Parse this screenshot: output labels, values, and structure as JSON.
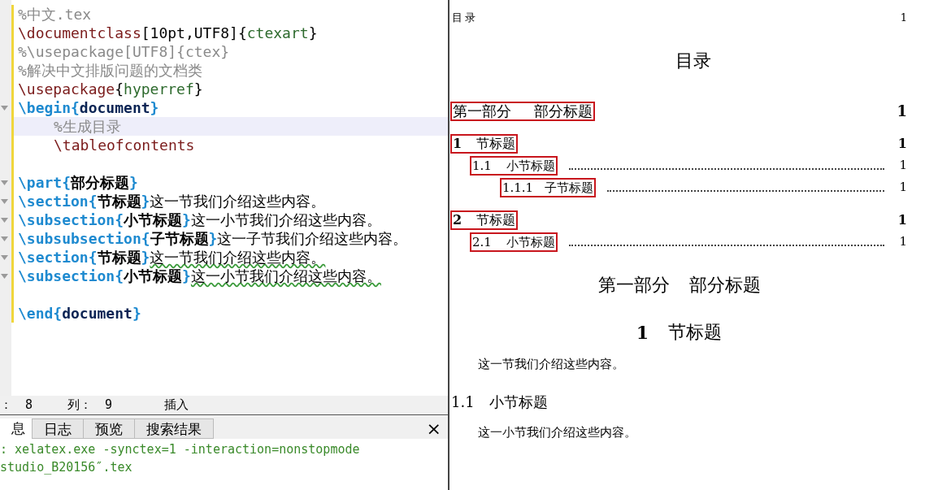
{
  "editor": {
    "lines": [
      {
        "fold": false,
        "current": false,
        "indented": false,
        "segments": [
          {
            "kind": "comment",
            "text": "%中文.tex"
          }
        ]
      },
      {
        "fold": false,
        "current": false,
        "indented": false,
        "segments": [
          {
            "kind": "command",
            "text": "\\documentclass"
          },
          {
            "kind": "plain",
            "text": "[10pt,UTF8]{"
          },
          {
            "kind": "argument",
            "text": "ctexart"
          },
          {
            "kind": "plain",
            "text": "}"
          }
        ]
      },
      {
        "fold": false,
        "current": false,
        "indented": false,
        "segments": [
          {
            "kind": "comment",
            "text": "%\\usepackage[UTF8]{ctex}"
          }
        ]
      },
      {
        "fold": false,
        "current": false,
        "indented": false,
        "segments": [
          {
            "kind": "comment",
            "text": "%解决中文排版问题的文档类"
          }
        ]
      },
      {
        "fold": false,
        "current": false,
        "indented": false,
        "segments": [
          {
            "kind": "command",
            "text": "\\usepackage"
          },
          {
            "kind": "plain",
            "text": "{"
          },
          {
            "kind": "argument",
            "text": "hyperref"
          },
          {
            "kind": "plain",
            "text": "}"
          }
        ]
      },
      {
        "fold": true,
        "current": false,
        "indented": false,
        "segments": [
          {
            "kind": "keyword",
            "text": "\\begin{"
          },
          {
            "kind": "environment",
            "text": "document"
          },
          {
            "kind": "keyword",
            "text": "}"
          }
        ]
      },
      {
        "fold": false,
        "current": true,
        "indented": true,
        "segments": [
          {
            "kind": "comment",
            "text": "%生成目录"
          }
        ]
      },
      {
        "fold": false,
        "current": false,
        "indented": true,
        "segments": [
          {
            "kind": "command",
            "text": "\\tableofcontents"
          }
        ]
      },
      {
        "kind": "blank"
      },
      {
        "fold": true,
        "current": false,
        "indented": false,
        "segments": [
          {
            "kind": "keyword",
            "text": "\\part{"
          },
          {
            "kind": "heading",
            "text": "部分标题"
          },
          {
            "kind": "keyword",
            "text": "}"
          }
        ]
      },
      {
        "fold": true,
        "current": false,
        "indented": false,
        "segments": [
          {
            "kind": "keyword",
            "text": "\\section{"
          },
          {
            "kind": "heading",
            "text": "节标题"
          },
          {
            "kind": "keyword",
            "text": "}"
          },
          {
            "kind": "text",
            "text": "这一节我们介绍这些内容。"
          }
        ]
      },
      {
        "fold": true,
        "current": false,
        "indented": false,
        "segments": [
          {
            "kind": "keyword",
            "text": "\\subsection{"
          },
          {
            "kind": "heading",
            "text": "小节标题"
          },
          {
            "kind": "keyword",
            "text": "}"
          },
          {
            "kind": "text",
            "text": "这一小节我们介绍这些内容。"
          }
        ]
      },
      {
        "fold": true,
        "current": false,
        "indented": false,
        "segments": [
          {
            "kind": "keyword",
            "text": "\\subsubsection{"
          },
          {
            "kind": "heading",
            "text": "子节标题"
          },
          {
            "kind": "keyword",
            "text": "}"
          },
          {
            "kind": "text",
            "text": "这一子节我们介绍这些内容。"
          }
        ]
      },
      {
        "fold": true,
        "current": false,
        "indented": false,
        "segments": [
          {
            "kind": "keyword",
            "text": "\\section{"
          },
          {
            "kind": "heading",
            "text": "节标题"
          },
          {
            "kind": "keyword",
            "text": "}"
          },
          {
            "kind": "squiggle",
            "text": "这一节我们介绍这些内容。"
          }
        ]
      },
      {
        "fold": true,
        "current": false,
        "indented": false,
        "segments": [
          {
            "kind": "keyword",
            "text": "\\subsection{"
          },
          {
            "kind": "heading",
            "text": "小节标题"
          },
          {
            "kind": "keyword",
            "text": "}"
          },
          {
            "kind": "squiggle",
            "text": "这一小节我们介绍这些内容。"
          }
        ]
      },
      {
        "kind": "blank"
      },
      {
        "fold": false,
        "current": false,
        "indented": false,
        "segments": [
          {
            "kind": "keyword",
            "text": "\\end{"
          },
          {
            "kind": "environment",
            "text": "document"
          },
          {
            "kind": "keyword",
            "text": "}"
          }
        ]
      }
    ]
  },
  "status_bar": {
    "row_label": "：",
    "row": "8",
    "column_label": "列：",
    "column": "9",
    "mode": "插入"
  },
  "output_panel": {
    "tabs": [
      {
        "label": "息",
        "selected": true
      },
      {
        "label": "日志",
        "selected": false
      },
      {
        "label": "预览",
        "selected": false
      },
      {
        "label": "搜索结果",
        "selected": false
      }
    ],
    "close": "×",
    "lines": [
      ": xelatex.exe -synctex=1 -interaction=nonstopmode",
      "studio_B20156″.tex"
    ]
  },
  "preview": {
    "header": {
      "title": "目录",
      "page": "1"
    },
    "toc_title": "目录",
    "toc": [
      {
        "kind": "part",
        "number": "第一部分",
        "title": "部分标题",
        "page": "1",
        "children": [
          {
            "kind": "section",
            "number": "1",
            "title": "节标题",
            "page": "1",
            "children": [
              {
                "kind": "subsection",
                "number": "1.1",
                "title": "小节标题",
                "page": "1",
                "children": [
                  {
                    "kind": "subsubsection",
                    "number": "1.1.1",
                    "title": "子节标题",
                    "page": "1"
                  }
                ]
              }
            ]
          },
          {
            "kind": "section",
            "number": "2",
            "title": "节标题",
            "page": "1",
            "children": [
              {
                "kind": "subsection",
                "number": "2.1",
                "title": "小节标题",
                "page": "1"
              }
            ]
          }
        ]
      }
    ],
    "body": [
      {
        "kind": "part_heading",
        "number": "第一部分",
        "title": "部分标题"
      },
      {
        "kind": "section_heading",
        "number": "1",
        "title": "节标题"
      },
      {
        "kind": "paragraph",
        "text": "这一节我们介绍这些内容。"
      },
      {
        "kind": "subsection_heading",
        "number": "1.1",
        "title": "小节标题"
      },
      {
        "kind": "paragraph",
        "text": "这一小节我们介绍这些内容。"
      }
    ]
  }
}
